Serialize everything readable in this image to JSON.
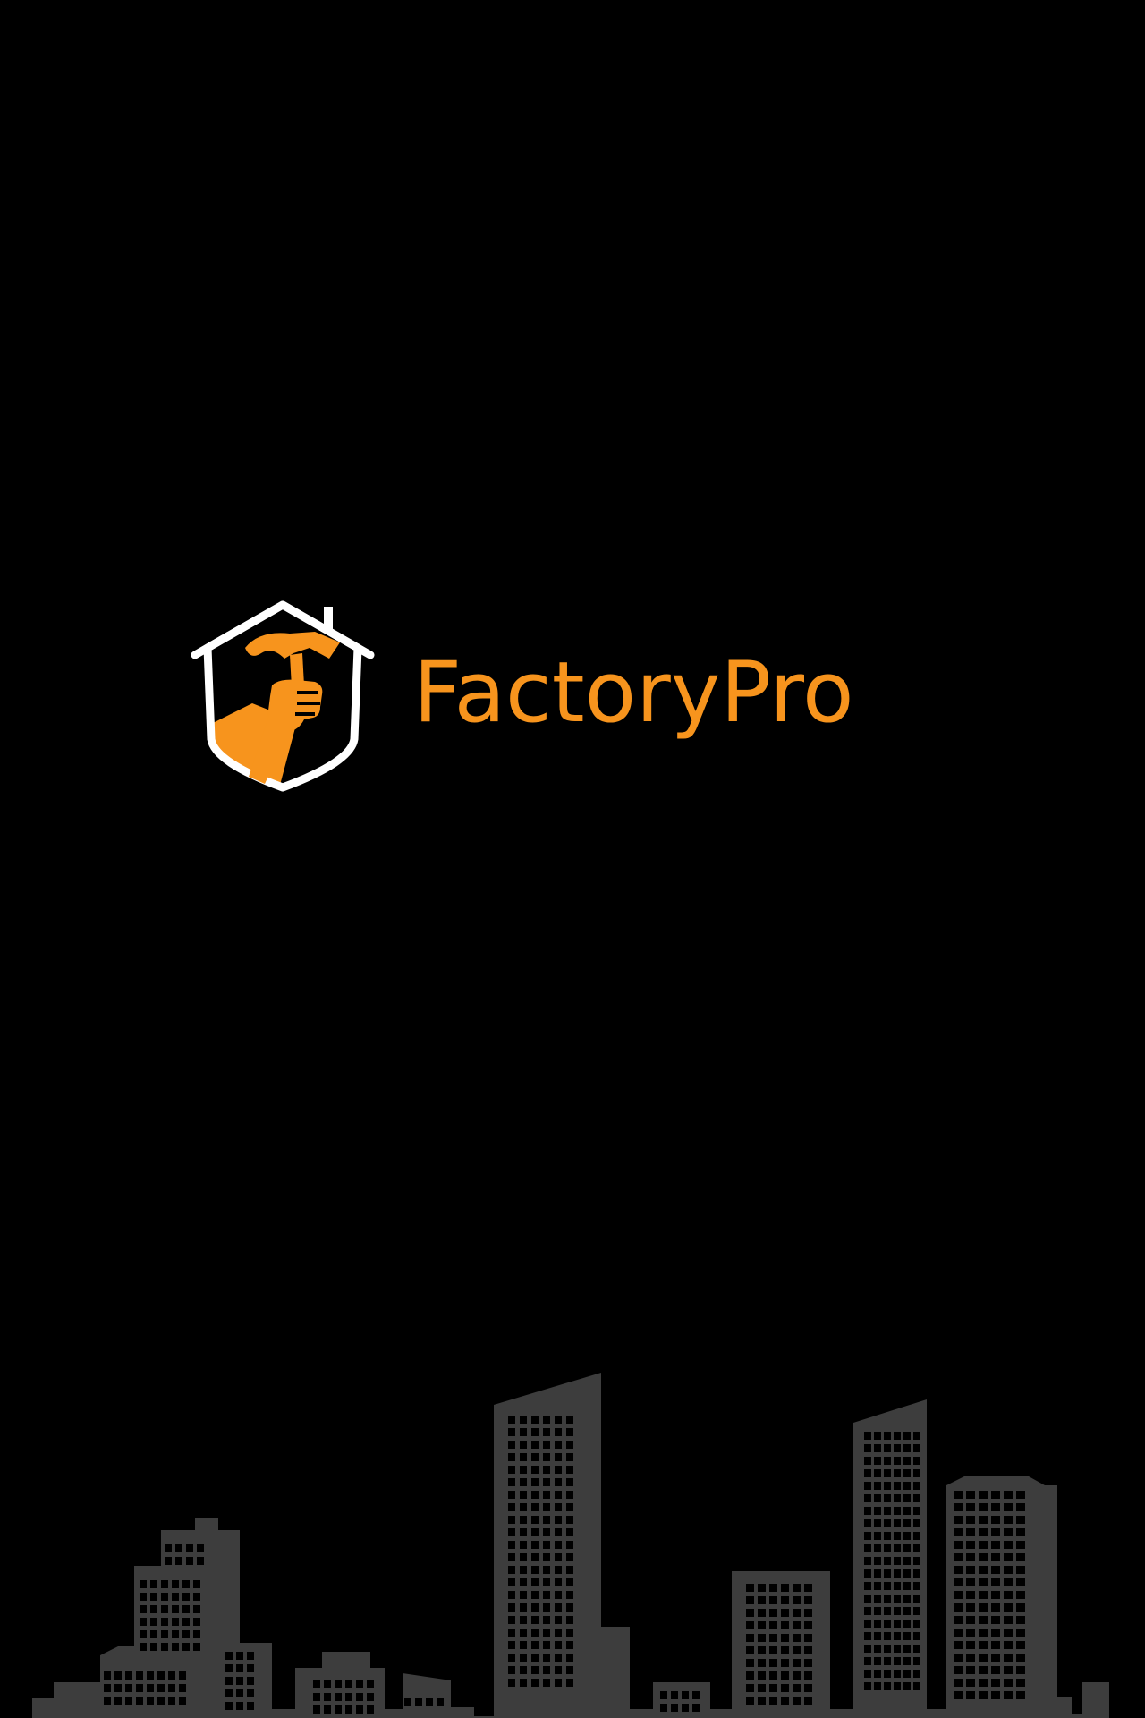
{
  "splash": {
    "brand_name": "FactoryPro",
    "logo_icon": "house-shield-hammer-icon",
    "background_illustration": "city-skyline"
  },
  "colors": {
    "background": "#000000",
    "brand_orange": "#f7941d",
    "logo_outline": "#ffffff",
    "skyline": "#3d3d3d",
    "windows": "#000000"
  }
}
